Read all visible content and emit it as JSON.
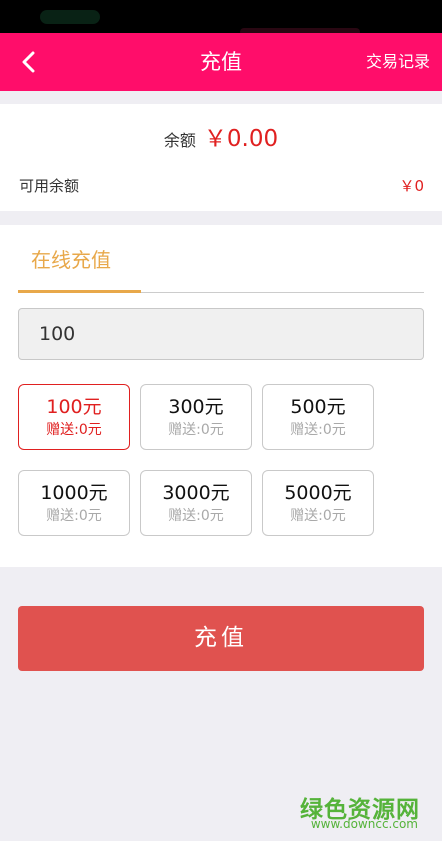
{
  "navbar": {
    "title": "充值",
    "right_label": "交易记录",
    "back_icon": "chevron-left-icon"
  },
  "balance": {
    "label": "余额",
    "value": "￥0.00",
    "available_label": "可用余额",
    "available_value": "￥0"
  },
  "recharge": {
    "tab_label": "在线充值",
    "amount_value": "100",
    "options": [
      {
        "amount": "100元",
        "bonus": "赠送:0元",
        "selected": true
      },
      {
        "amount": "300元",
        "bonus": "赠送:0元",
        "selected": false
      },
      {
        "amount": "500元",
        "bonus": "赠送:0元",
        "selected": false
      },
      {
        "amount": "1000元",
        "bonus": "赠送:0元",
        "selected": false
      },
      {
        "amount": "3000元",
        "bonus": "赠送:0元",
        "selected": false
      },
      {
        "amount": "5000元",
        "bonus": "赠送:0元",
        "selected": false
      }
    ],
    "submit_label": "充值"
  },
  "watermark": {
    "main": "绿色资源网",
    "sub": "www.downcc.com"
  },
  "colors": {
    "navbar": "#ff0d6a",
    "accent_red": "#e02020",
    "tab_accent": "#e8a84a",
    "submit": "#e0524f",
    "watermark": "#55b33a"
  }
}
